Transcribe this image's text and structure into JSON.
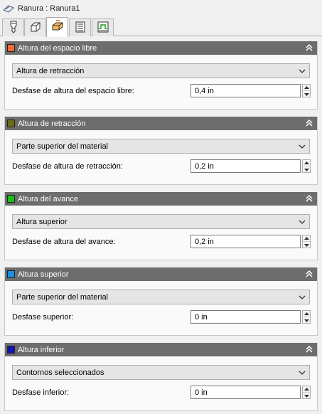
{
  "window": {
    "title": "Ranura : Ranura1",
    "title_icon": "slot-op-icon"
  },
  "tabs": [
    {
      "name": "tool-tab",
      "icon": "tool-icon",
      "active": false
    },
    {
      "name": "geometry-tab",
      "icon": "geometry-icon",
      "active": false
    },
    {
      "name": "heights-tab",
      "icon": "heights-icon",
      "active": true
    },
    {
      "name": "passes-tab",
      "icon": "passes-icon",
      "active": false
    },
    {
      "name": "linking-tab",
      "icon": "linking-icon",
      "active": false
    }
  ],
  "sections": [
    {
      "title": "Altura del espacio libre",
      "color": "#f06a3a",
      "dropdown": "Altura de retracción",
      "offset_label": "Desfase de altura del espacio libre:",
      "offset_value": "0,4 in"
    },
    {
      "title": "Altura de retracción",
      "color": "#6b6b1a",
      "dropdown": "Parte superior del material",
      "offset_label": "Desfase de altura de retracción:",
      "offset_value": "0,2 in"
    },
    {
      "title": "Altura del avance",
      "color": "#17c217",
      "dropdown": "Altura superior",
      "offset_label": "Desfase de altura del avance:",
      "offset_value": "0,2 in"
    },
    {
      "title": "Altura superior",
      "color": "#1a8de8",
      "dropdown": "Parte superior del material",
      "offset_label": "Desfase superior:",
      "offset_value": "0 in"
    },
    {
      "title": "Altura inferior",
      "color": "#1414b4",
      "dropdown": "Contornos seleccionados",
      "offset_label": "Desfase inferior:",
      "offset_value": "0 in"
    }
  ]
}
